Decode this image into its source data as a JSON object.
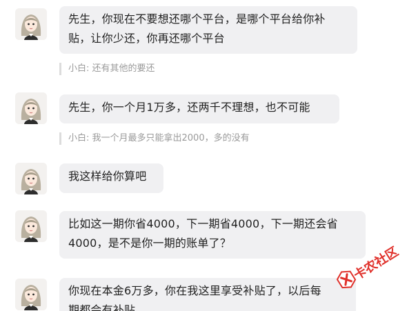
{
  "messages": [
    {
      "avatar_icon": "girl-avatar-icon",
      "lines": [
        "先生，你现在不要想还哪个平台，是哪个平台给你补",
        "贴，让你少还，你再还哪个平台"
      ],
      "quote": "小白: 还有其他的要还"
    },
    {
      "avatar_icon": "girl-avatar-icon",
      "lines": [
        "先生，你一个月1万多，还两千不理想，也不可能"
      ],
      "quote": "小白: 我一个月最多只能拿出2000，多的没有"
    },
    {
      "avatar_icon": "girl-avatar-icon",
      "lines": [
        "我这样给你算吧"
      ]
    },
    {
      "avatar_icon": "girl-avatar-icon",
      "lines": [
        "比如这一期你省4000，下一期省4000，下一期还会省",
        "4000，是不是你一期的账单了？"
      ]
    },
    {
      "avatar_icon": "girl-avatar-icon",
      "lines": [
        "你现在本金6万多，你在我这里享受补贴了，以后每",
        "期都会有补贴"
      ]
    }
  ],
  "watermark": {
    "text": "卡农社区",
    "icon": "kanong-logo-icon",
    "color": "#e0302a"
  }
}
